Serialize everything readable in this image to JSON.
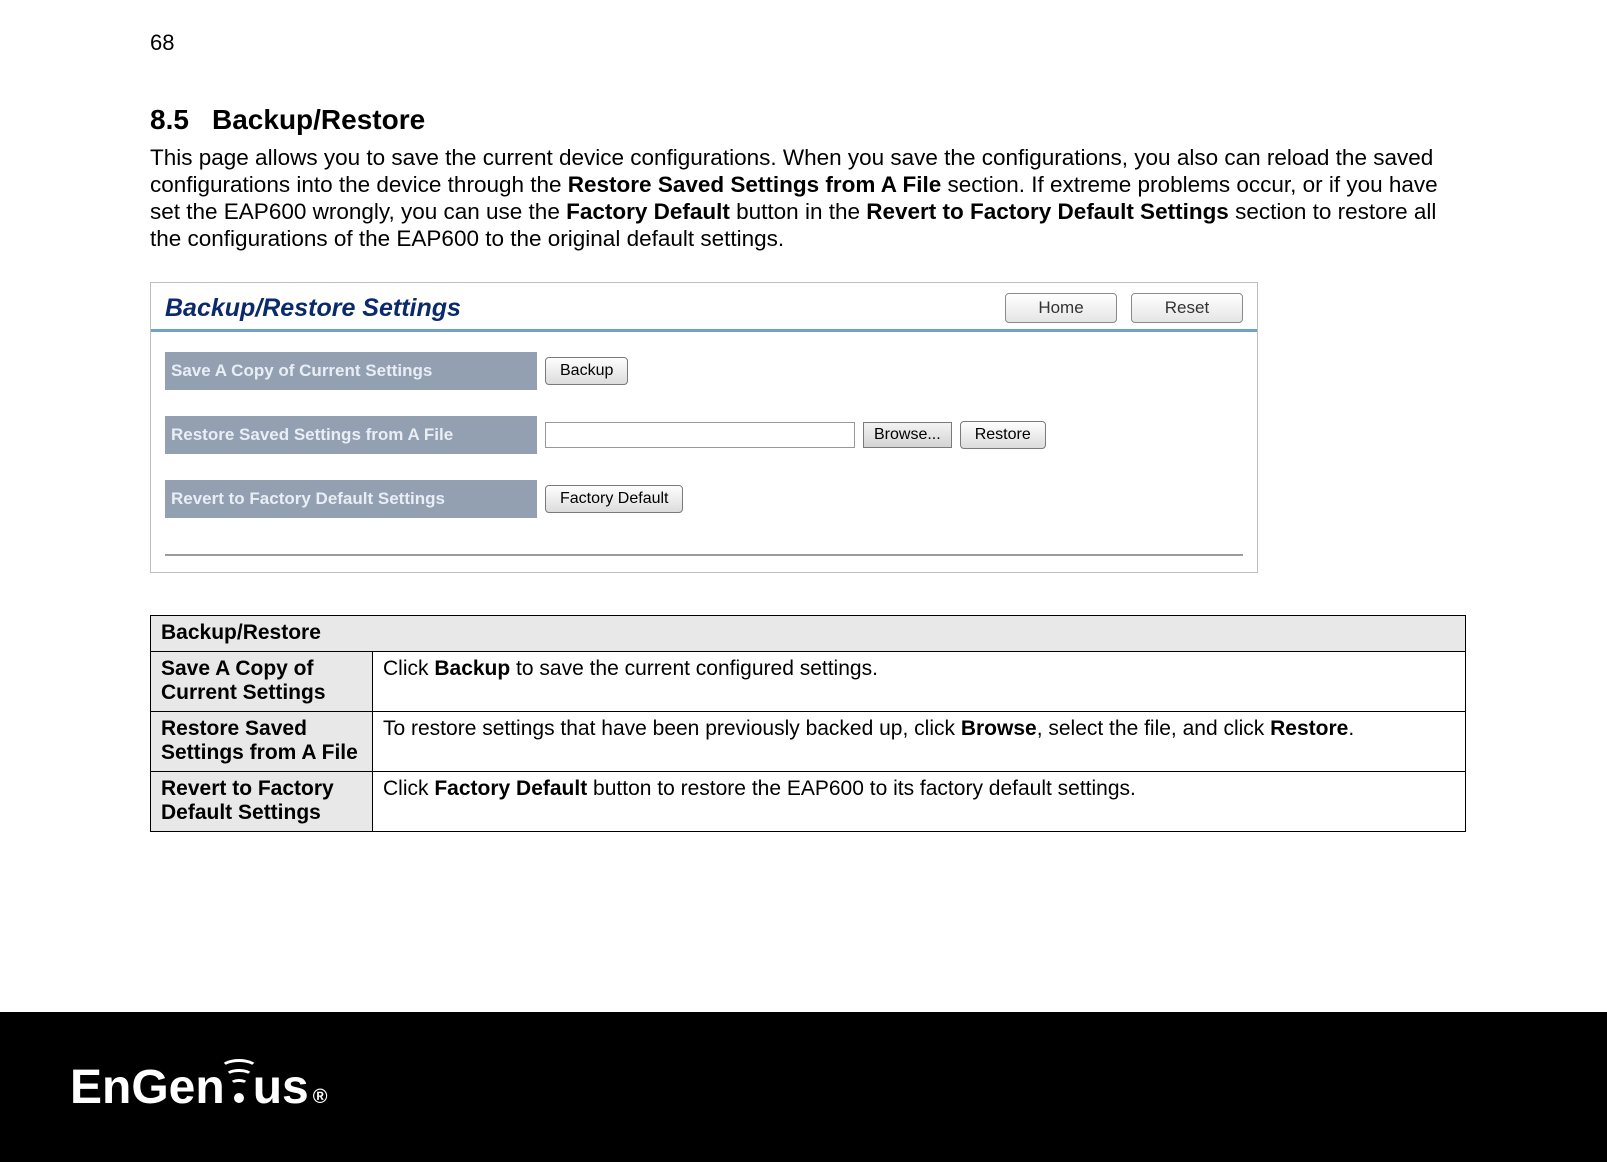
{
  "page": {
    "number": "68"
  },
  "section": {
    "number": "8.5",
    "title": "Backup/Restore"
  },
  "intro": {
    "t1": "This page allows you to save the current device configurations. When you save the configurations, you also can reload the saved configurations into the device through the ",
    "b1": "Restore Saved Settings from A File",
    "t2": " section. If extreme problems occur, or if you have set the EAP600 wrongly, you can use the ",
    "b2": "Factory Default",
    "t3": " button in the ",
    "b3": "Revert to Factory Default Settings",
    "t4": " section to restore all the configurations of the EAP600 to the original default settings."
  },
  "panel": {
    "title": "Backup/Restore Settings",
    "home": "Home",
    "reset": "Reset",
    "rows": {
      "save": {
        "label": "Save A Copy of Current Settings",
        "button": "Backup"
      },
      "restore": {
        "label": "Restore Saved Settings from A File",
        "browse": "Browse...",
        "button": "Restore"
      },
      "revert": {
        "label": "Revert to Factory Default Settings",
        "button": "Factory Default"
      }
    }
  },
  "table": {
    "header": "Backup/Restore",
    "rows": [
      {
        "label": "Save A Copy of Current Settings",
        "d1": "Click ",
        "b1": "Backup",
        "d2": " to save the current configured settings."
      },
      {
        "label": "Restore Saved Settings from A File",
        "d1": "To restore settings that have been previously backed up, click ",
        "b1": "Browse",
        "d2": ", select the file, and click ",
        "b2": "Restore",
        "d3": "."
      },
      {
        "label": "Revert to Factory Default Settings",
        "d1": "Click ",
        "b1": "Factory Default",
        "d2": " button to restore the EAP600 to its factory default settings."
      }
    ]
  },
  "logo": {
    "part1": "EnGen",
    "part2": "us",
    "reg": "®"
  }
}
